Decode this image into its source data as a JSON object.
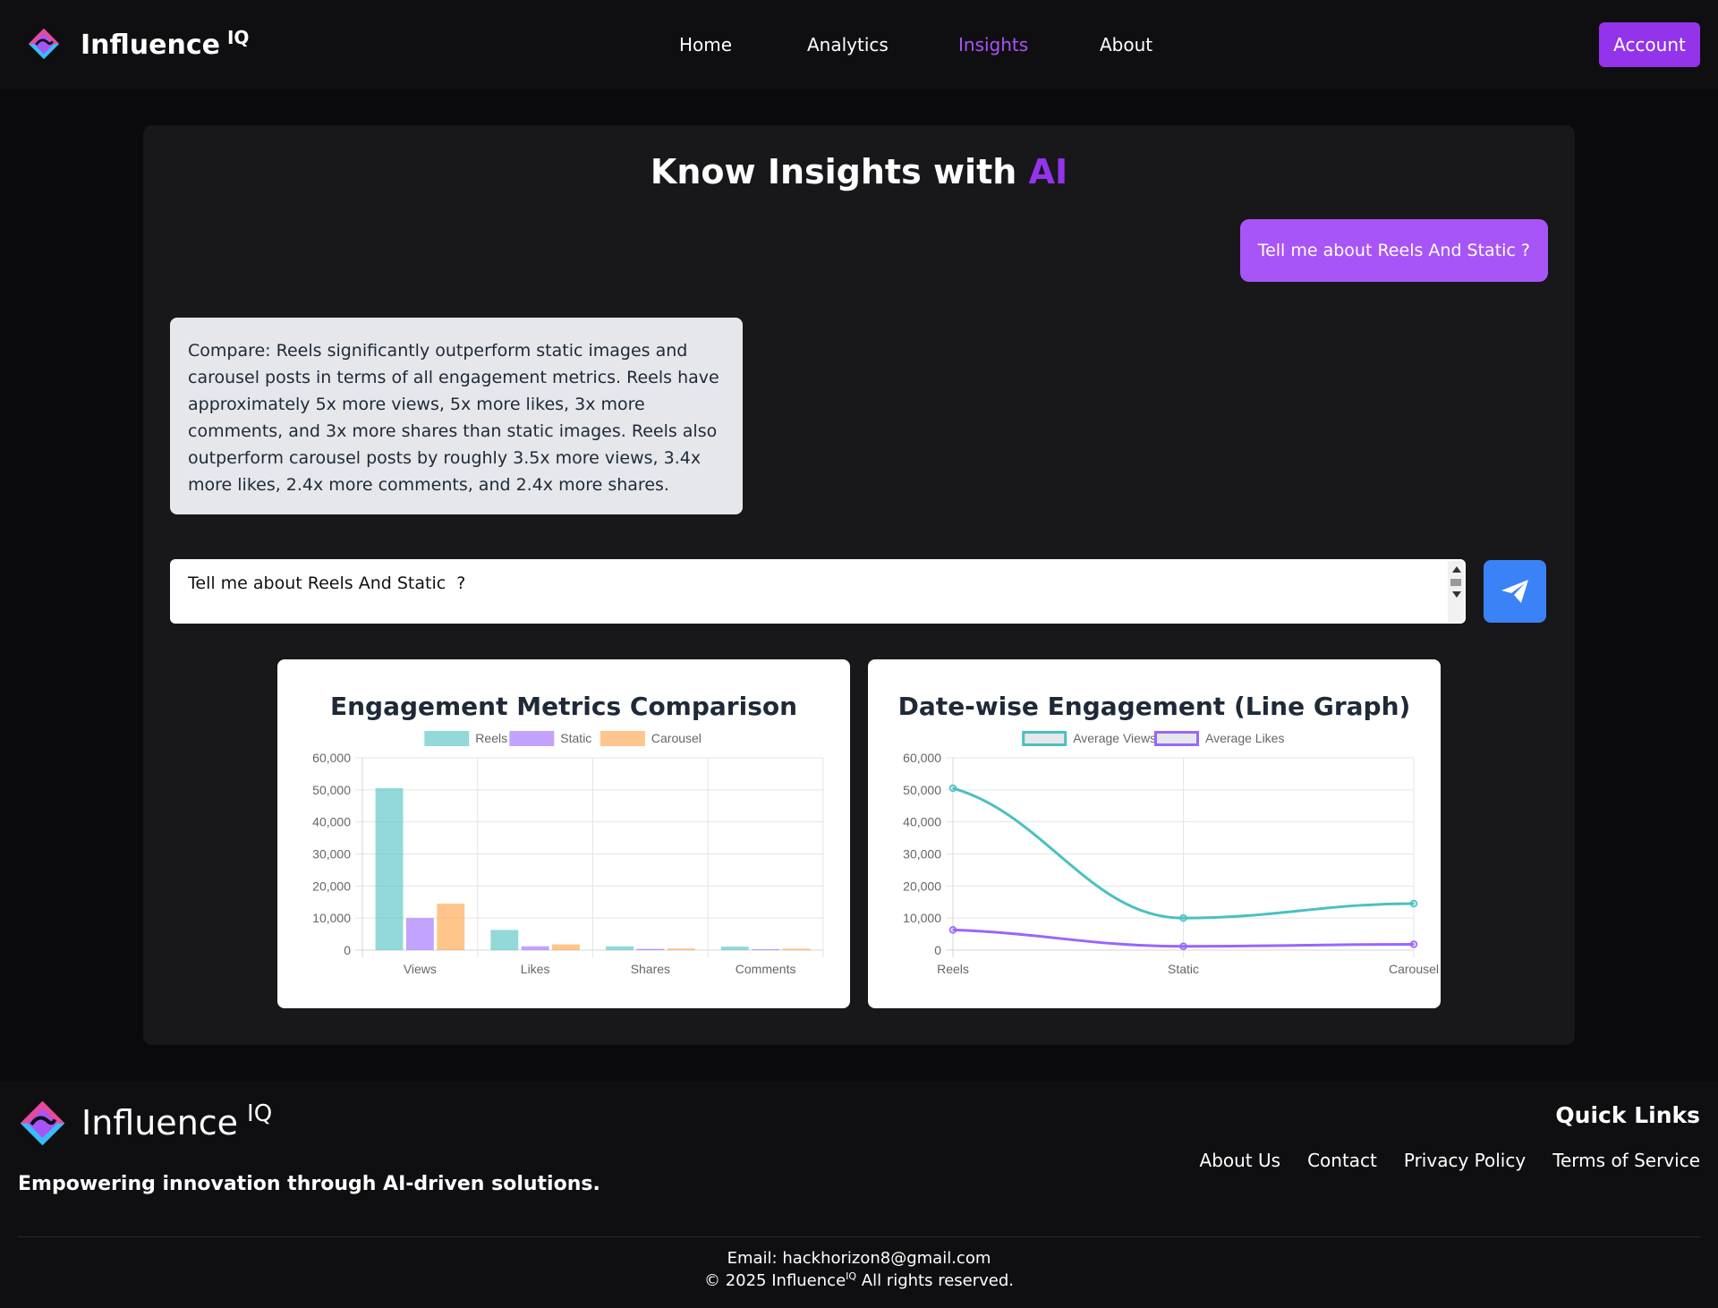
{
  "nav": {
    "brand": "Influence",
    "brand_sup": "IQ",
    "links": [
      "Home",
      "Analytics",
      "Insights",
      "About"
    ],
    "active_link": "Insights",
    "account_label": "Account"
  },
  "main": {
    "title_prefix": "Know Insights with ",
    "title_accent": "AI",
    "user_message": "Tell me about Reels And Static ?",
    "ai_message": "Compare: Reels significantly outperform static images and carousel posts in terms of all engagement metrics. Reels have approximately 5x more views, 5x more likes, 3x more comments, and 3x more shares than static images. Reels also outperform carousel posts by roughly 3.5x more views, 3.4x more likes, 2.4x more comments, and 2.4x more shares.",
    "input_value": "Tell me about Reels And Static  ?",
    "send_icon": "paper-plane-icon"
  },
  "chart_data": [
    {
      "type": "bar",
      "title": "Engagement Metrics Comparison",
      "categories": [
        "Views",
        "Likes",
        "Shares",
        "Comments"
      ],
      "series": [
        {
          "name": "Reels",
          "values": [
            50500,
            6300,
            1200,
            1100
          ],
          "color": "#4bc0c0"
        },
        {
          "name": "Static",
          "values": [
            10000,
            1200,
            400,
            300
          ],
          "color": "#9966ff"
        },
        {
          "name": "Carousel",
          "values": [
            14500,
            1800,
            500,
            450
          ],
          "color": "#ff9f40"
        }
      ],
      "ylim": [
        0,
        60000
      ],
      "yticks": [
        "0",
        "10,000",
        "20,000",
        "30,000",
        "40,000",
        "50,000",
        "60,000"
      ],
      "legend": "top",
      "grid": true
    },
    {
      "type": "line",
      "title": "Date-wise Engagement (Line Graph)",
      "categories": [
        "Reels",
        "Static",
        "Carousel"
      ],
      "series": [
        {
          "name": "Average Views",
          "values": [
            50500,
            10000,
            14500
          ],
          "color": "#4bc0c0"
        },
        {
          "name": "Average Likes",
          "values": [
            6300,
            1200,
            1800
          ],
          "color": "#9966ff"
        }
      ],
      "ylim": [
        0,
        60000
      ],
      "yticks": [
        "0",
        "10,000",
        "20,000",
        "30,000",
        "40,000",
        "50,000",
        "60,000"
      ],
      "legend": "top",
      "grid": true
    }
  ],
  "footer": {
    "brand": "Influence",
    "brand_sup": "IQ",
    "tagline": "Empowering innovation through AI-driven solutions.",
    "quick_links_title": "Quick Links",
    "quick_links": [
      "About Us",
      "Contact",
      "Privacy Policy",
      "Terms of Service"
    ],
    "email": "Email: hackhorizon8@gmail.com",
    "copyright_prefix": "© 2025 Influence",
    "copyright_sup": "IQ",
    "copyright_suffix": " All rights reserved."
  }
}
